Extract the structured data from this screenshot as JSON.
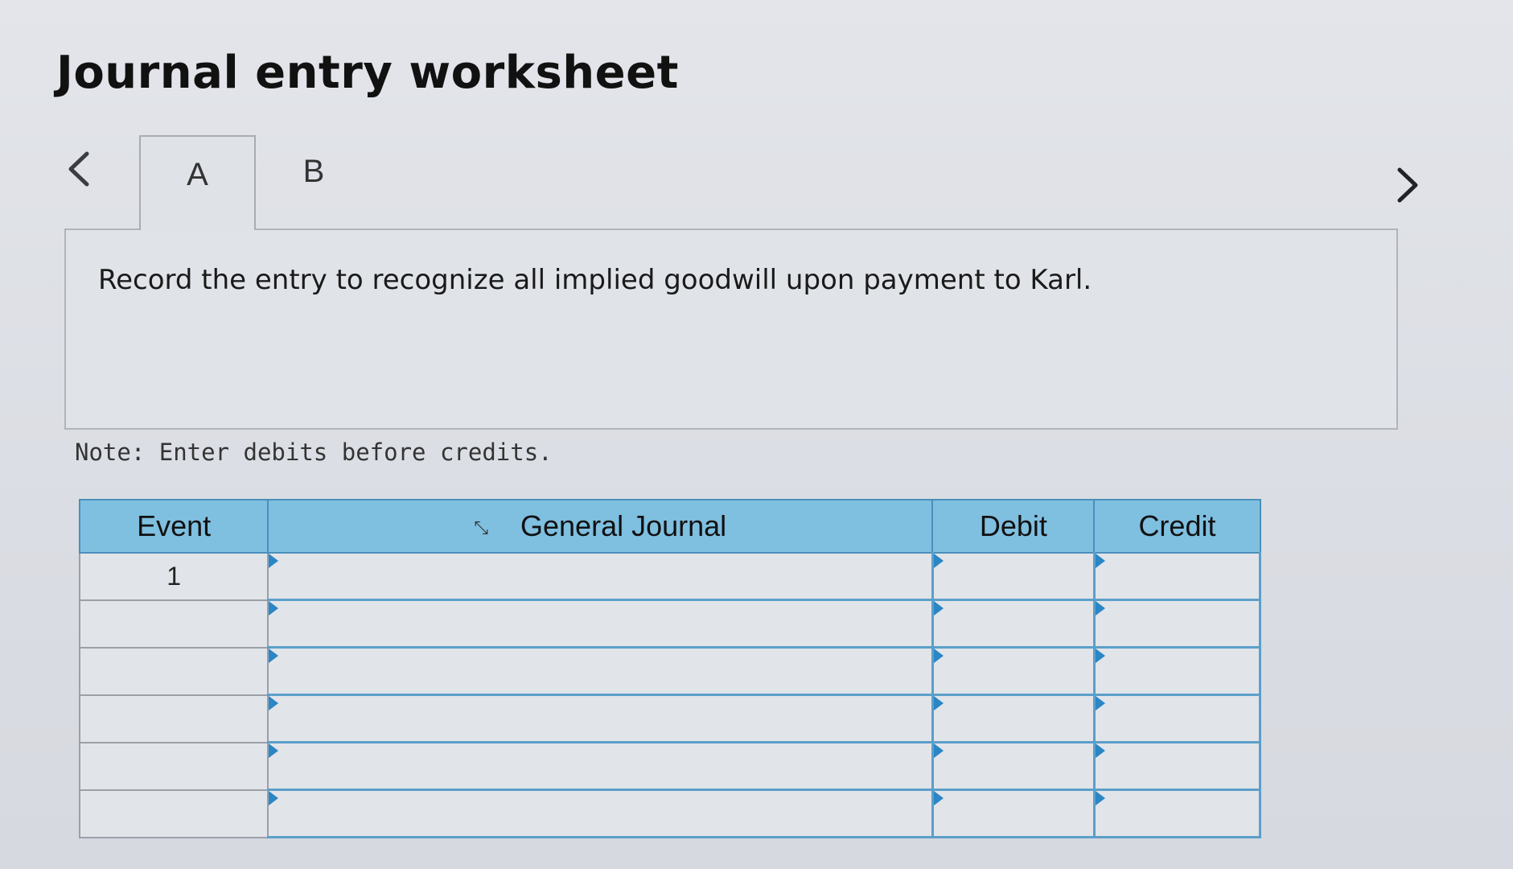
{
  "title": "Journal entry worksheet",
  "tabs": [
    {
      "label": "A",
      "active": true
    },
    {
      "label": "B",
      "active": false
    }
  ],
  "navigation": {
    "prev_icon": "chevron-left-icon",
    "next_icon": "chevron-right-icon"
  },
  "prompt": "Record the entry to recognize all implied goodwill upon payment to Karl.",
  "note": "Note: Enter debits before credits.",
  "table": {
    "headers": {
      "event": "Event",
      "journal": "General Journal",
      "debit": "Debit",
      "credit": "Credit"
    },
    "rows": [
      {
        "event": "1",
        "journal": "",
        "debit": "",
        "credit": ""
      },
      {
        "event": "",
        "journal": "",
        "debit": "",
        "credit": ""
      },
      {
        "event": "",
        "journal": "",
        "debit": "",
        "credit": ""
      },
      {
        "event": "",
        "journal": "",
        "debit": "",
        "credit": ""
      },
      {
        "event": "",
        "journal": "",
        "debit": "",
        "credit": ""
      },
      {
        "event": "",
        "journal": "",
        "debit": "",
        "credit": ""
      }
    ]
  },
  "colors": {
    "header_bg": "#7fbfe0",
    "grid_line": "#5b9fca",
    "row_marker": "#2a86c5"
  }
}
